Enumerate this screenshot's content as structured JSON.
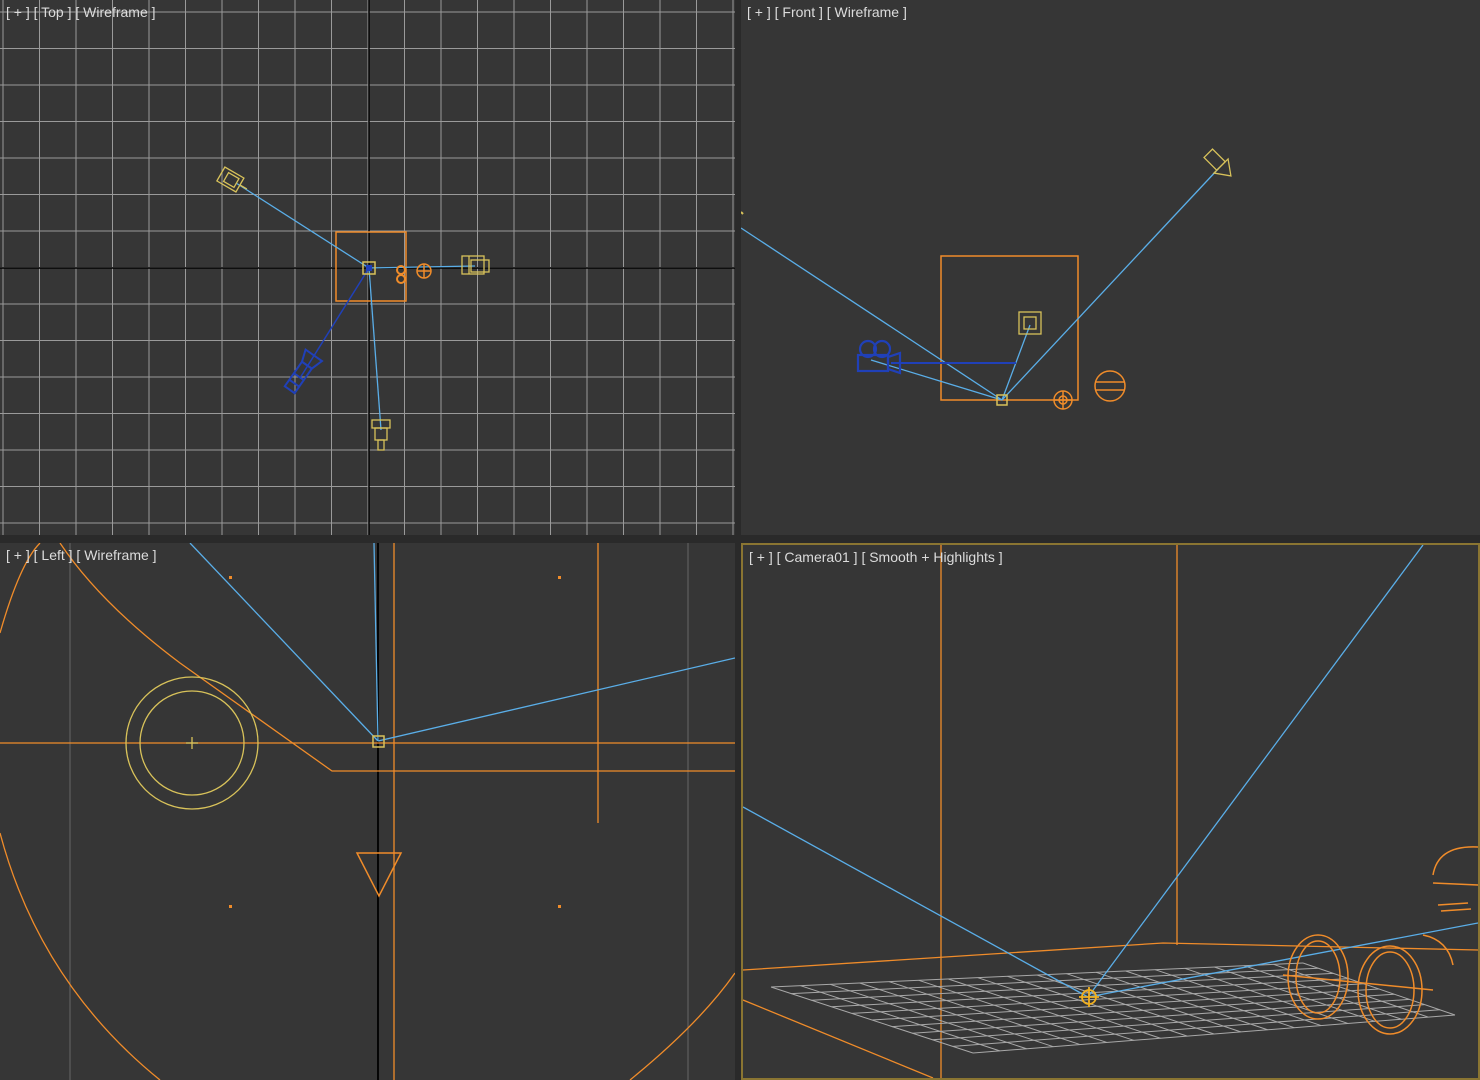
{
  "viewports": {
    "top": {
      "label": "[ + ] [ Top ] [ Wireframe ]"
    },
    "front": {
      "label": "[ + ] [ Front ] [ Wireframe ]"
    },
    "left": {
      "label": "[ + ] [ Left ] [ Wireframe ]"
    },
    "camera": {
      "label": "[ + ] [ Camera01 ] [ Smooth + Highlights ]"
    }
  },
  "colors": {
    "background": "#363636",
    "grid": "#9a9a9a",
    "axis": "#000000",
    "object_orange": "#f08c2a",
    "object_yellow": "#d8c25a",
    "link_blue": "#5aaee8",
    "camera_blue": "#2040b8",
    "active_border": "#8a7532"
  },
  "icons": [
    "light-icon",
    "camera-icon",
    "target-icon",
    "helper-icon"
  ]
}
